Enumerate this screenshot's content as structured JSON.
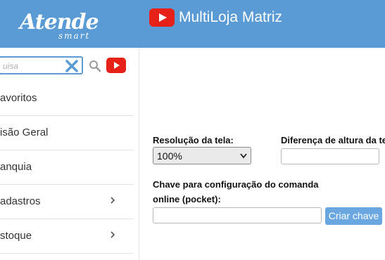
{
  "header": {
    "logo_text": "Atende",
    "logo_sub": "smart",
    "title": "MultiLoja Matriz",
    "video_icon": "youtube-icon"
  },
  "sidebar": {
    "search": {
      "placeholder": "uisa",
      "value": ""
    },
    "icons": {
      "clear": "clear-x-icon",
      "search": "search-icon",
      "video": "youtube-icon"
    },
    "items": [
      {
        "label": "avoritos",
        "has_submenu": false
      },
      {
        "label": "isão Geral",
        "has_submenu": false
      },
      {
        "label": "anquia",
        "has_submenu": false
      },
      {
        "label": "adastros",
        "has_submenu": true
      },
      {
        "label": "stoque",
        "has_submenu": true
      }
    ]
  },
  "main": {
    "resolution_label": "Resolução da tela:",
    "resolution_value": "100%",
    "height_diff_label": "Diferença de altura da te",
    "height_diff_value": "",
    "key_label_line1": "Chave para configuração do comanda",
    "key_label_line2": "online (pocket):",
    "key_value": "",
    "create_key_button": "Criar chave"
  },
  "colors": {
    "header_bg": "#5b9bd5",
    "accent": "#5b9bd5",
    "button_bg": "#6aa7e0",
    "youtube_red": "#e62117"
  }
}
